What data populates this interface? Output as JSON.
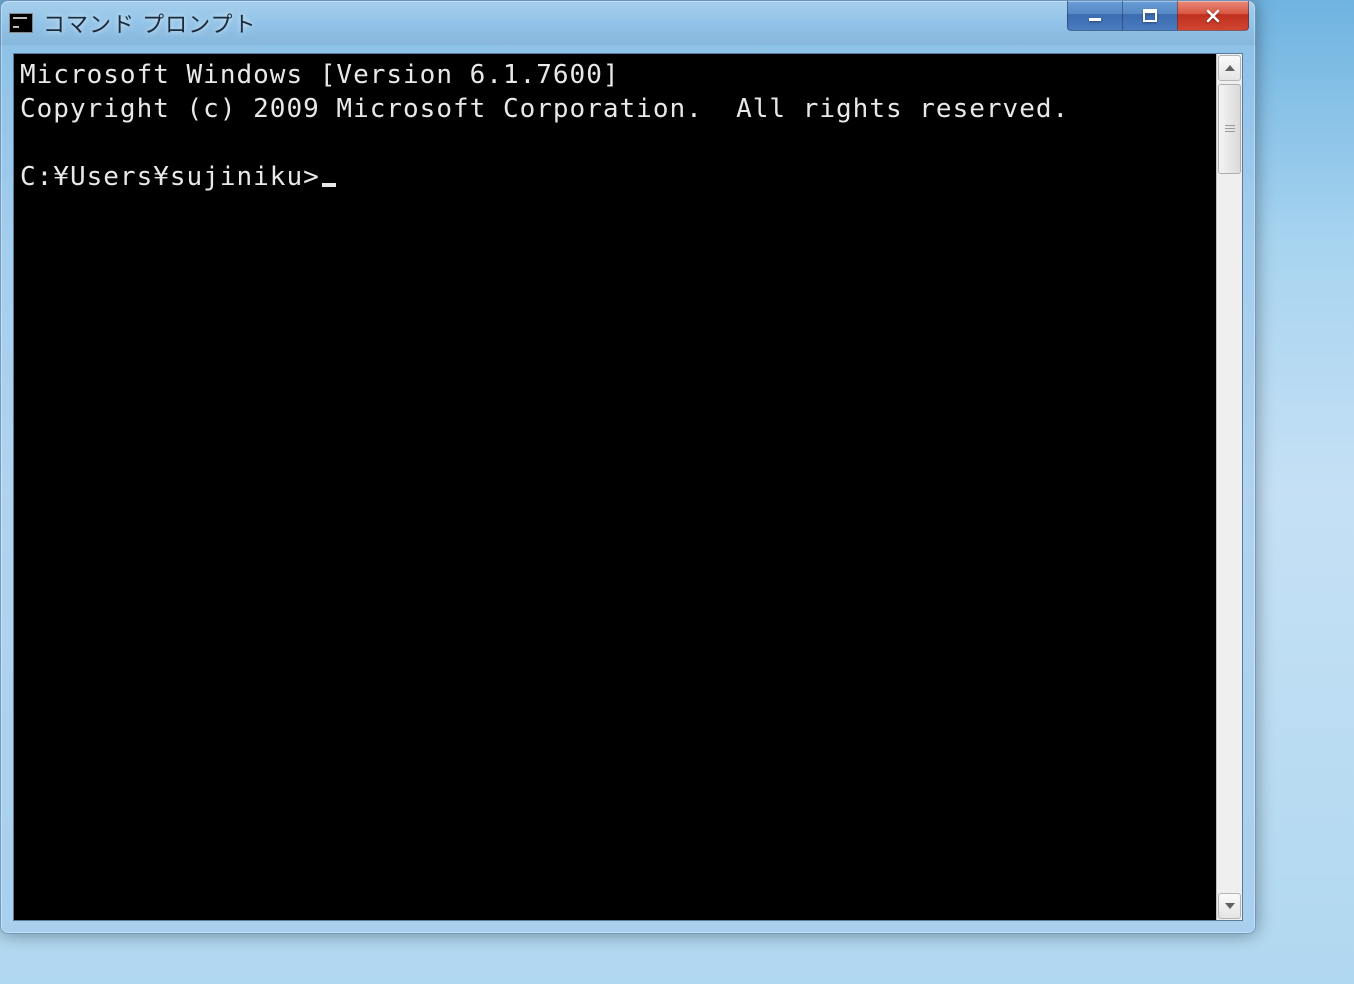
{
  "window": {
    "title": "コマンド プロンプト",
    "icon_name": "cmd-icon"
  },
  "terminal": {
    "line1": "Microsoft Windows [Version 6.1.7600]",
    "line2": "Copyright (c) 2009 Microsoft Corporation.  All rights reserved.",
    "blank": "",
    "prompt": "C:¥Users¥sujiniku>"
  }
}
